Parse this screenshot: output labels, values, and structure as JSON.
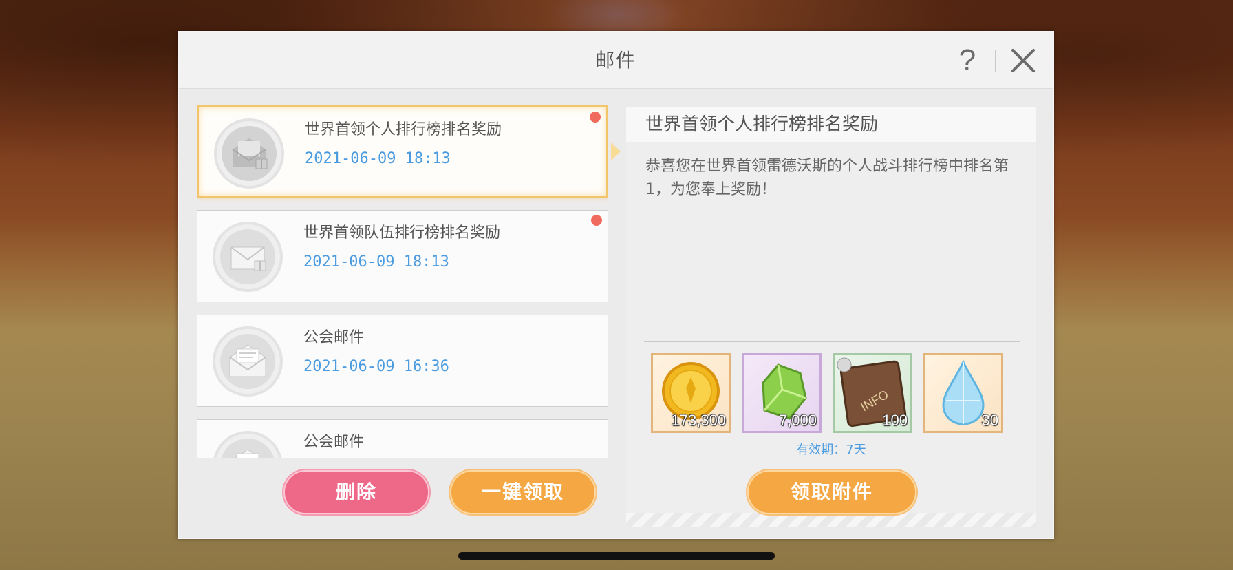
{
  "dialog": {
    "title": "邮件",
    "help_label": "?"
  },
  "mails": [
    {
      "title": "世界首领个人排行榜排名奖励",
      "date": "2021-06-09  18:13",
      "unread": true,
      "icon": "gift-mail-icon"
    },
    {
      "title": "世界首领队伍排行榜排名奖励",
      "date": "2021-06-09  18:13",
      "unread": true,
      "icon": "gift-mail-icon"
    },
    {
      "title": "公会邮件",
      "date": "2021-06-09  16:36",
      "unread": false,
      "icon": "letter-mail-icon"
    },
    {
      "title": "公会邮件",
      "date": "",
      "unread": false,
      "icon": "letter-mail-icon"
    }
  ],
  "list_buttons": {
    "delete": "删除",
    "claim_all": "一键领取"
  },
  "detail": {
    "title": "世界首领个人排行榜排名奖励",
    "body": "恭喜您在世界首领雷德沃斯的个人战斗排行榜中排名第1，为您奉上奖励！",
    "rewards": [
      {
        "name": "gold-coin-icon",
        "qty": "173,300"
      },
      {
        "name": "green-crystal-icon",
        "qty": "7,000"
      },
      {
        "name": "info-book-icon",
        "qty": "100"
      },
      {
        "name": "diamond-drop-icon",
        "qty": "30"
      }
    ],
    "expiry": "有效期：7天",
    "claim_button": "领取附件"
  },
  "colors": {
    "accent_orange": "#f4a743",
    "delete_pink": "#ee6888",
    "date_blue": "#4a9be0",
    "unread_red": "#f06b5e"
  }
}
